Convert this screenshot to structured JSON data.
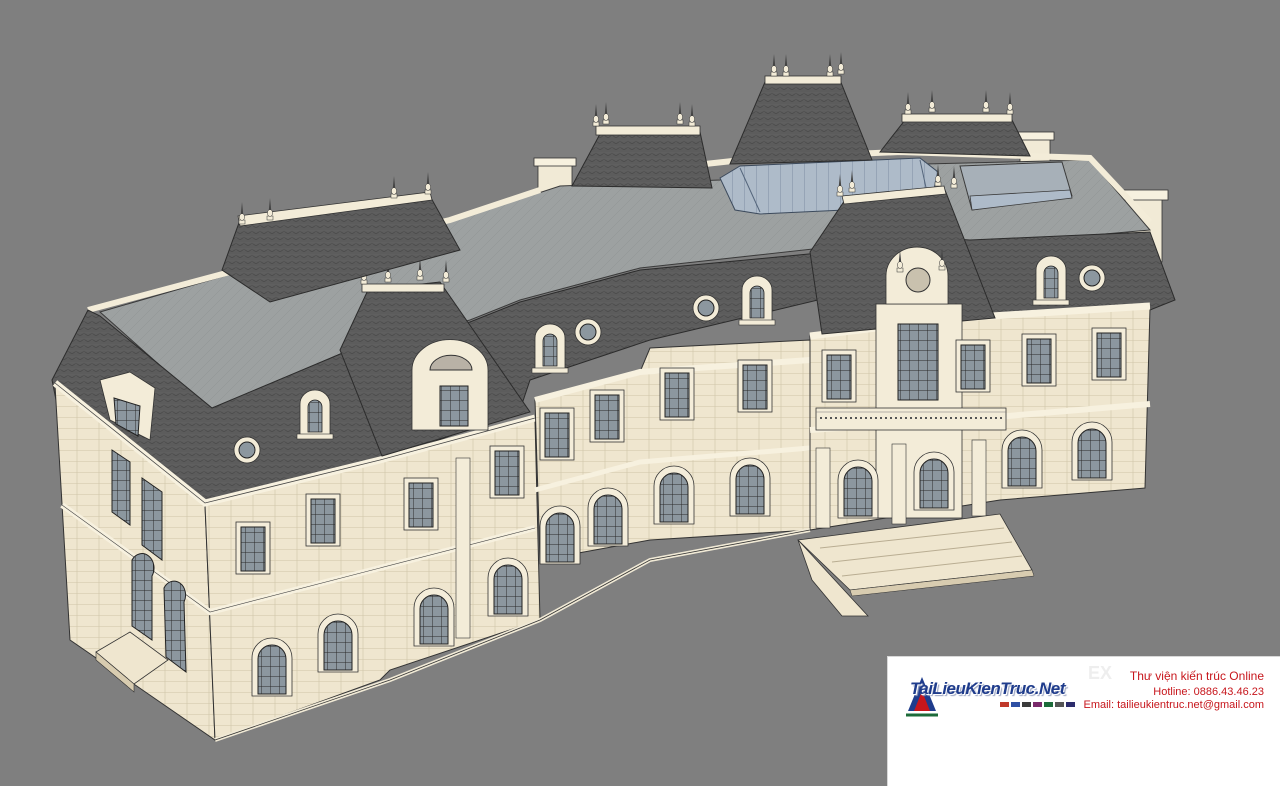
{
  "canvas": {
    "background": "#7f7f7f",
    "model_description_color_roof": "#5a5a5a",
    "wall_color": "#efe6cf",
    "trim_color": "#f5eedc",
    "glass_color": "#8f9ba3",
    "flat_roof_color": "#9a9e9e",
    "skylight_color": "#a9b5c4"
  },
  "watermark": {
    "brand": "TaiLieuKienTruc.Net",
    "title": "Thư viện kiến trúc Online",
    "hotline": "Hotline: 0886.43.46.23",
    "email": "Email: tailieukientruc.net@gmail.com",
    "ghost_text": "EX",
    "logo_icon": "tlkt-logo-icon",
    "swatch_colors": [
      "#c0392b",
      "#2e4fa3",
      "#3b3b3b",
      "#7a2a6a",
      "#1d6b3a",
      "#555555",
      "#2c2c6c"
    ]
  }
}
